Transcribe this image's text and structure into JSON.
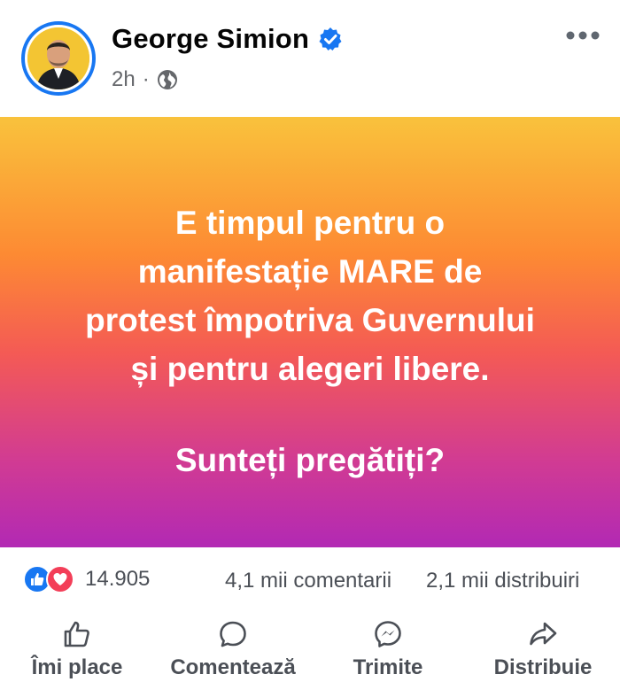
{
  "post": {
    "author": "George Simion",
    "time": "2h",
    "meta_separator": "·",
    "lines": [
      "E timpul pentru o",
      "manifestație MARE de",
      "protest împotriva Guvernului",
      "și pentru alegeri libere."
    ],
    "question": "Sunteți pregătiți?"
  },
  "stats": {
    "reaction_count": "14.905",
    "comments": "4,1 mii comentarii",
    "shares": "2,1 mii distribuiri"
  },
  "actions": {
    "like": "Îmi place",
    "comment": "Comentează",
    "send": "Trimite",
    "share": "Distribuie"
  },
  "colors": {
    "facebook_blue": "#1877f2",
    "love_red": "#f33e58",
    "gradient_top": "#f9c23c",
    "gradient_bottom": "#b229b4"
  }
}
